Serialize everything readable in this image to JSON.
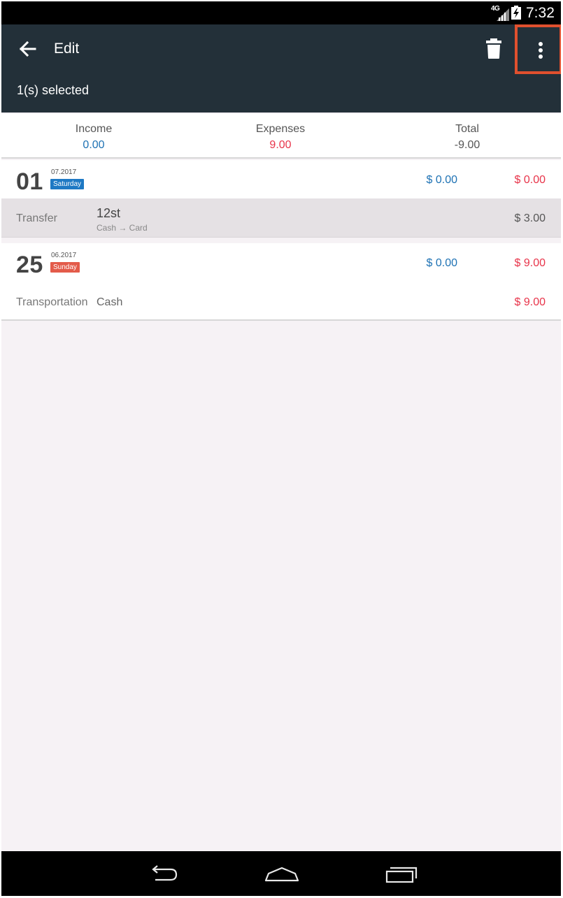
{
  "colors": {
    "app_bar": "#233039",
    "highlight_box": "#e0502e",
    "income_blue": "#1e72b4",
    "expense_red": "#e8344a",
    "selected_row": "#e5e1e4",
    "saturday_badge": "#1e79c4",
    "sunday_badge": "#e35b4a"
  },
  "status_bar": {
    "network": "4G",
    "time": "7:32",
    "icons": [
      "signal-icon",
      "battery-icon"
    ]
  },
  "app_bar": {
    "title": "Edit",
    "selection_text": "1(s) selected",
    "icons": [
      "back-arrow-icon",
      "trash-icon",
      "more-vert-icon"
    ]
  },
  "summary": {
    "income_label": "Income",
    "income_value": "0.00",
    "expenses_label": "Expenses",
    "expenses_value": "9.00",
    "total_label": "Total",
    "total_value": "-9.00"
  },
  "days": [
    {
      "day": "01",
      "month_year": "07.2017",
      "weekday": "Saturday",
      "income": "$ 0.00",
      "expense": "$ 0.00",
      "transactions": [
        {
          "category": "Transfer",
          "name": "12st",
          "route": "Cash → Card",
          "account": "",
          "amount": "$ 3.00",
          "selected": true
        }
      ]
    },
    {
      "day": "25",
      "month_year": "06.2017",
      "weekday": "Sunday",
      "income": "$ 0.00",
      "expense": "$ 9.00",
      "transactions": [
        {
          "category": "Transportation",
          "name": "",
          "route": "",
          "account": "Cash",
          "amount": "$ 9.00",
          "selected": false
        }
      ]
    }
  ],
  "nav_bar": {
    "icons": [
      "nav-back-icon",
      "nav-home-icon",
      "nav-recents-icon"
    ]
  }
}
